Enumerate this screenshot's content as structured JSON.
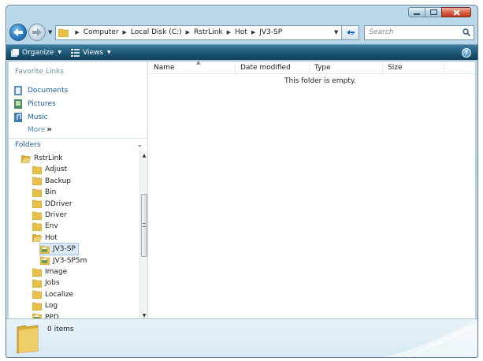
{
  "window": {
    "caption_buttons": [
      "minimize",
      "maximize",
      "close"
    ]
  },
  "address_bar": {
    "crumbs": [
      "Computer",
      "Local Disk (C:)",
      "RstrLink",
      "Hot",
      "JV3-SP"
    ],
    "search_placeholder": "Search"
  },
  "command_bar": {
    "organize_label": "Organize",
    "views_label": "Views"
  },
  "nav_pane": {
    "favorite_links_header": "Favorite Links",
    "favorites": [
      {
        "label": "Documents",
        "icon": "documents-icon"
      },
      {
        "label": "Pictures",
        "icon": "pictures-icon"
      },
      {
        "label": "Music",
        "icon": "music-icon"
      }
    ],
    "more_label": "More",
    "folders_header": "Folders",
    "tree": [
      {
        "label": "RstrLink",
        "level": 0,
        "icon": "folder-open-icon"
      },
      {
        "label": "Adjust",
        "level": 1,
        "icon": "folder-icon"
      },
      {
        "label": "Backup",
        "level": 1,
        "icon": "folder-icon"
      },
      {
        "label": "Bin",
        "level": 1,
        "icon": "folder-icon"
      },
      {
        "label": "DDriver",
        "level": 1,
        "icon": "folder-icon"
      },
      {
        "label": "Driver",
        "level": 1,
        "icon": "folder-icon"
      },
      {
        "label": "Env",
        "level": 1,
        "icon": "folder-icon"
      },
      {
        "label": "Hot",
        "level": 1,
        "icon": "folder-open-icon"
      },
      {
        "label": "JV3-SP",
        "level": 2,
        "icon": "printer-folder-icon",
        "selected": true
      },
      {
        "label": "JV3-SP5m",
        "level": 2,
        "icon": "printer-folder-icon"
      },
      {
        "label": "Image",
        "level": 1,
        "icon": "folder-icon"
      },
      {
        "label": "Jobs",
        "level": 1,
        "icon": "folder-icon"
      },
      {
        "label": "Localize",
        "level": 1,
        "icon": "folder-icon"
      },
      {
        "label": "Log",
        "level": 1,
        "icon": "folder-icon"
      },
      {
        "label": "PPD",
        "level": 1,
        "icon": "printer-folder-icon"
      }
    ]
  },
  "file_list": {
    "columns": [
      "Name",
      "Date modified",
      "Type",
      "Size"
    ],
    "empty_message": "This folder is empty."
  },
  "details_pane": {
    "item_count": "0 items"
  },
  "colors": {
    "link_blue": "#1b5ea8",
    "command_bar": "#1f5a79",
    "frame": "#a9cde2"
  }
}
